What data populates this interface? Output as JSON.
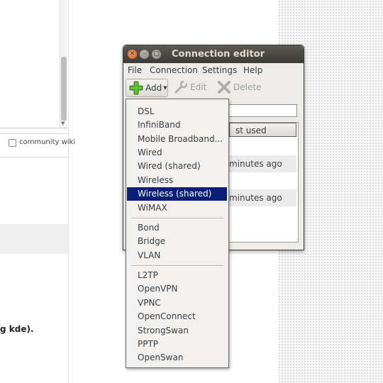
{
  "background": {
    "checkbox_label": "community wiki",
    "text_fragment": "g kde)."
  },
  "window": {
    "title": "Connection editor",
    "menu": [
      "File",
      "Connection",
      "Settings",
      "Help"
    ],
    "toolbar": {
      "add_label": "Add",
      "edit_label": "Edit",
      "delete_label": "Delete"
    },
    "list": {
      "header_fragment": "st used",
      "rows": [
        "minutes ago",
        "minutes ago"
      ]
    }
  },
  "add_menu": {
    "group1": [
      "DSL",
      "InfiniBand",
      "Mobile Broadband...",
      "Wired",
      "Wired (shared)",
      "Wireless",
      "Wireless (shared)",
      "WiMAX"
    ],
    "group2": [
      "Bond",
      "Bridge",
      "VLAN"
    ],
    "group3": [
      "L2TP",
      "OpenVPN",
      "VPNC",
      "OpenConnect",
      "StrongSwan",
      "PPTP",
      "OpenSwan"
    ],
    "highlighted": "Wireless (shared)"
  },
  "colors": {
    "highlight": "#0b1e7a",
    "titlebar": "#3c3b37",
    "close_button": "#e05a1a"
  },
  "icons": {
    "add": "plus-icon",
    "edit": "wrench-icon",
    "delete": "x-icon"
  }
}
